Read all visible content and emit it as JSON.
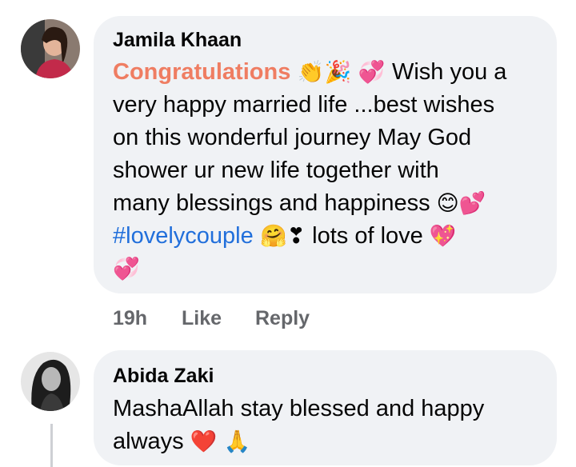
{
  "comments": [
    {
      "author": "Jamila Khaan",
      "avatar_icon": "woman-photo-avatar",
      "text_lines": [
        {
          "parts": [
            {
              "t": "Congratulations",
              "style": "cong"
            },
            {
              "t": " 👏🎉 💞 ",
              "style": "emoji"
            },
            {
              "t": "Wish you a",
              "style": "plain"
            }
          ]
        },
        {
          "parts": [
            {
              "t": "very happy married life ...best wishes",
              "style": "plain"
            }
          ]
        },
        {
          "parts": [
            {
              "t": "on this wonderful journey May God",
              "style": "plain"
            }
          ]
        },
        {
          "parts": [
            {
              "t": "shower ur new life together with",
              "style": "plain"
            }
          ]
        },
        {
          "parts": [
            {
              "t": "many blessings and happiness ",
              "style": "plain"
            },
            {
              "t": "😊💕",
              "style": "emoji"
            }
          ]
        },
        {
          "parts": [
            {
              "t": "#lovelycouple",
              "style": "hashtag"
            },
            {
              "t": " 🤗❣ ",
              "style": "emoji"
            },
            {
              "t": "lots of love ",
              "style": "plain"
            },
            {
              "t": "💖",
              "style": "emoji"
            }
          ]
        },
        {
          "parts": [
            {
              "t": "💞",
              "style": "emoji"
            }
          ]
        }
      ],
      "meta": {
        "time": "19h",
        "like": "Like",
        "reply": "Reply"
      }
    },
    {
      "author": "Abida Zaki",
      "avatar_icon": "woman-photo-avatar-bw",
      "text_lines": [
        {
          "parts": [
            {
              "t": "MashaAllah stay blessed and happy",
              "style": "plain"
            }
          ]
        },
        {
          "parts": [
            {
              "t": "always ",
              "style": "plain"
            },
            {
              "t": "❤️ 🙏",
              "style": "emoji"
            }
          ]
        }
      ]
    }
  ],
  "colors": {
    "bubble": "#f0f2f5",
    "congratulations": "#ef7d62",
    "hashtag": "#216fdb",
    "meta_text": "#65676b"
  }
}
